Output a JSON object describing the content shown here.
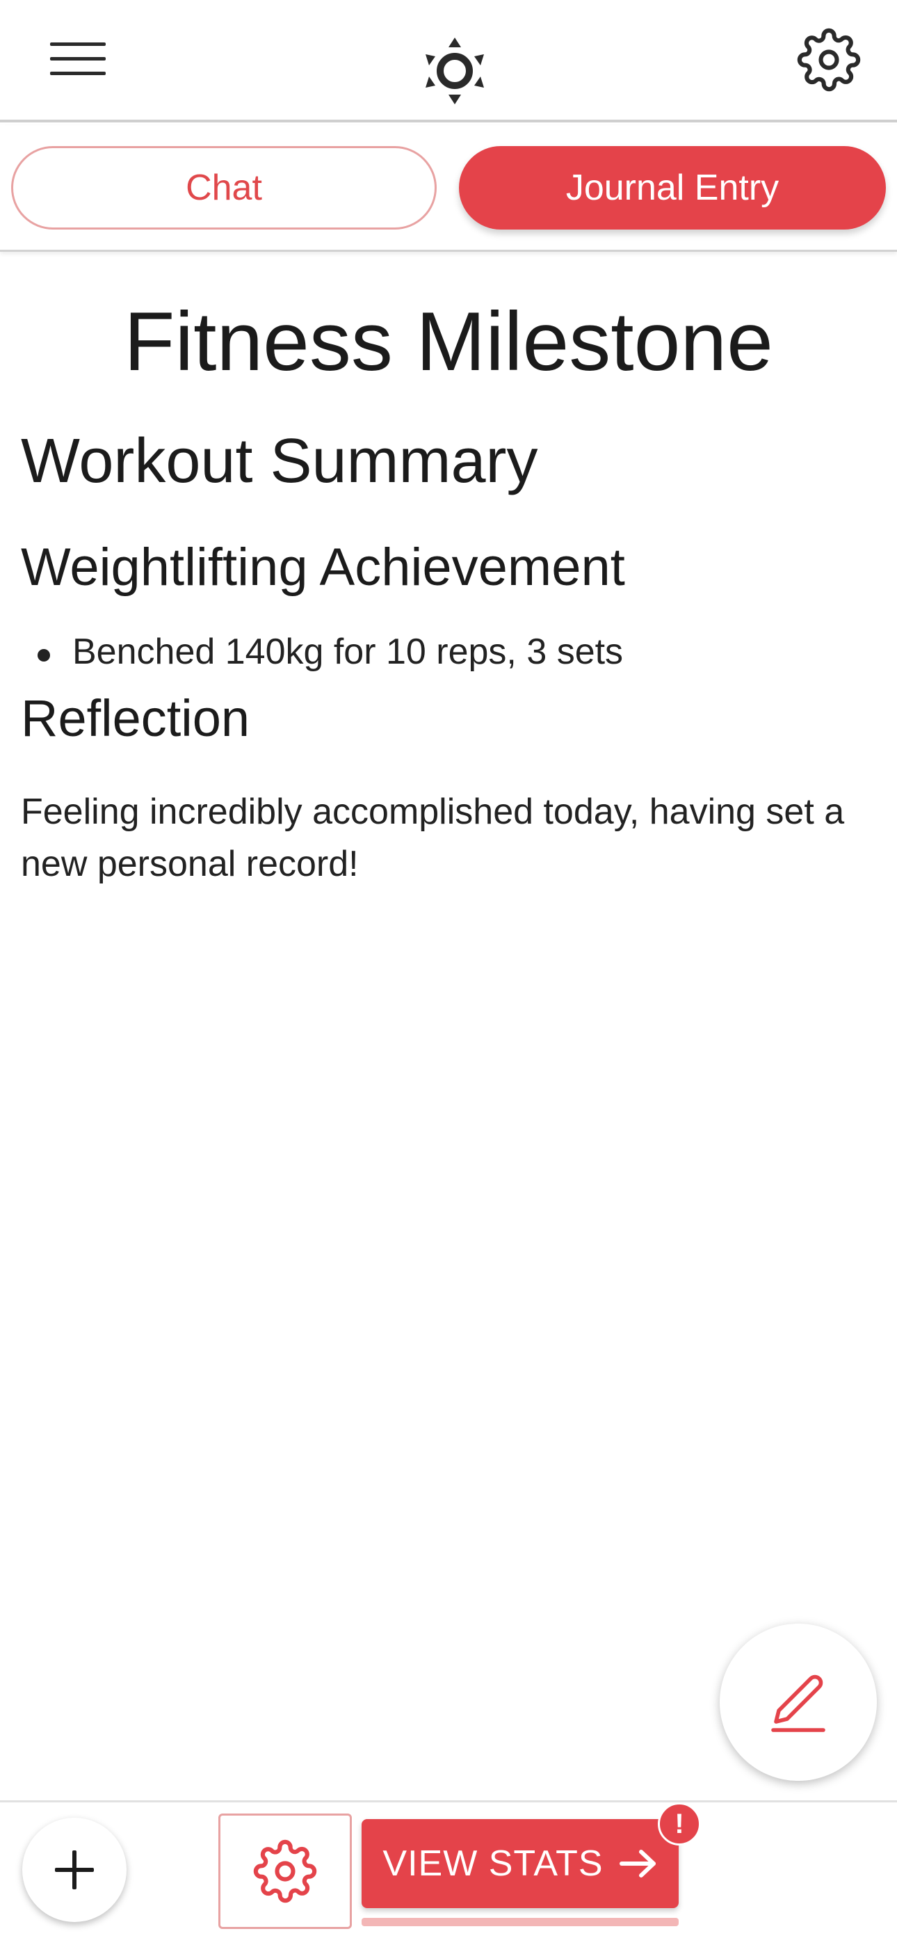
{
  "header": {
    "menu_icon": "hamburger-menu-icon",
    "logo_icon": "sun-logo-icon",
    "settings_icon": "gear-icon"
  },
  "tabs": [
    {
      "label": "Chat",
      "active": false
    },
    {
      "label": "Journal Entry",
      "active": true
    }
  ],
  "entry": {
    "title": "Fitness Milestone",
    "section_heading": "Workout Summary",
    "subsection_heading": "Weightlifting Achievement",
    "bullets": [
      "Benched 140kg for 10 reps, 3 sets"
    ],
    "reflection_heading": "Reflection",
    "reflection_text": "Feeling incredibly accomplished today, having set a new personal record!"
  },
  "fab": {
    "icon": "pencil-icon"
  },
  "bottom": {
    "add_icon": "plus-icon",
    "settings_icon": "gear-icon",
    "stats_label": "VIEW STATS",
    "stats_icon": "arrow-right-icon",
    "badge_text": "!"
  },
  "colors": {
    "accent": "#e4434a",
    "accent_light": "#e8a2a2",
    "text": "#1b1b1b"
  }
}
